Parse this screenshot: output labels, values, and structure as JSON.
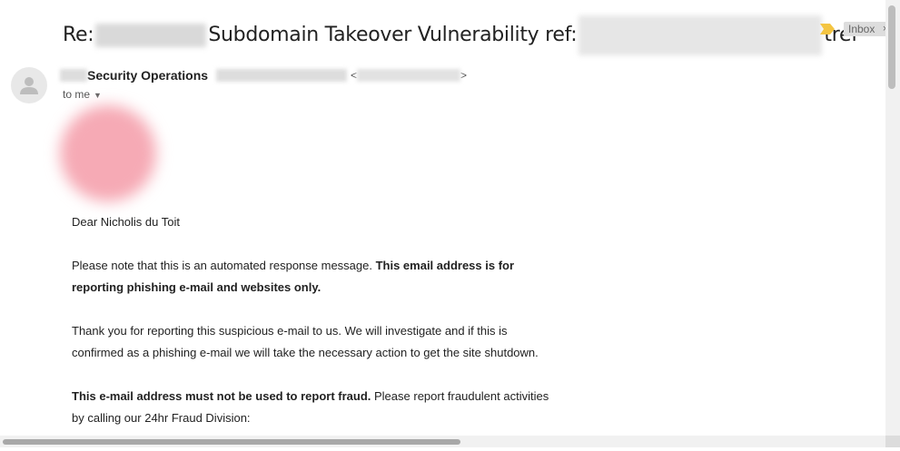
{
  "subject": {
    "prefix": "Re:",
    "middle": "Subdomain Takeover Vulnerability ref:",
    "suffix": "tref"
  },
  "labels": {
    "inbox": "Inbox",
    "remove": "×"
  },
  "sender": {
    "name": "Security Operations",
    "lt": "<",
    "gt": ">"
  },
  "recipient": {
    "to": "to me"
  },
  "message": {
    "greeting": "Dear Nicholis du Toit",
    "p1_normal": "Please note that this is an automated response message. ",
    "p1_bold": "This email address is for reporting phishing e-mail and websites only.",
    "p2": "Thank you for reporting this suspicious e-mail to us. We will investigate and if this is confirmed as a phishing e-mail we will take the necessary action to get the site shutdown.",
    "p3_bold": "This e-mail address must not be used to report fraud.",
    "p3_normal": " Please report fraudulent activities by calling our 24hr Fraud Division:"
  },
  "colors": {
    "importance": "#f4c542",
    "logo": "#f6aab5"
  }
}
